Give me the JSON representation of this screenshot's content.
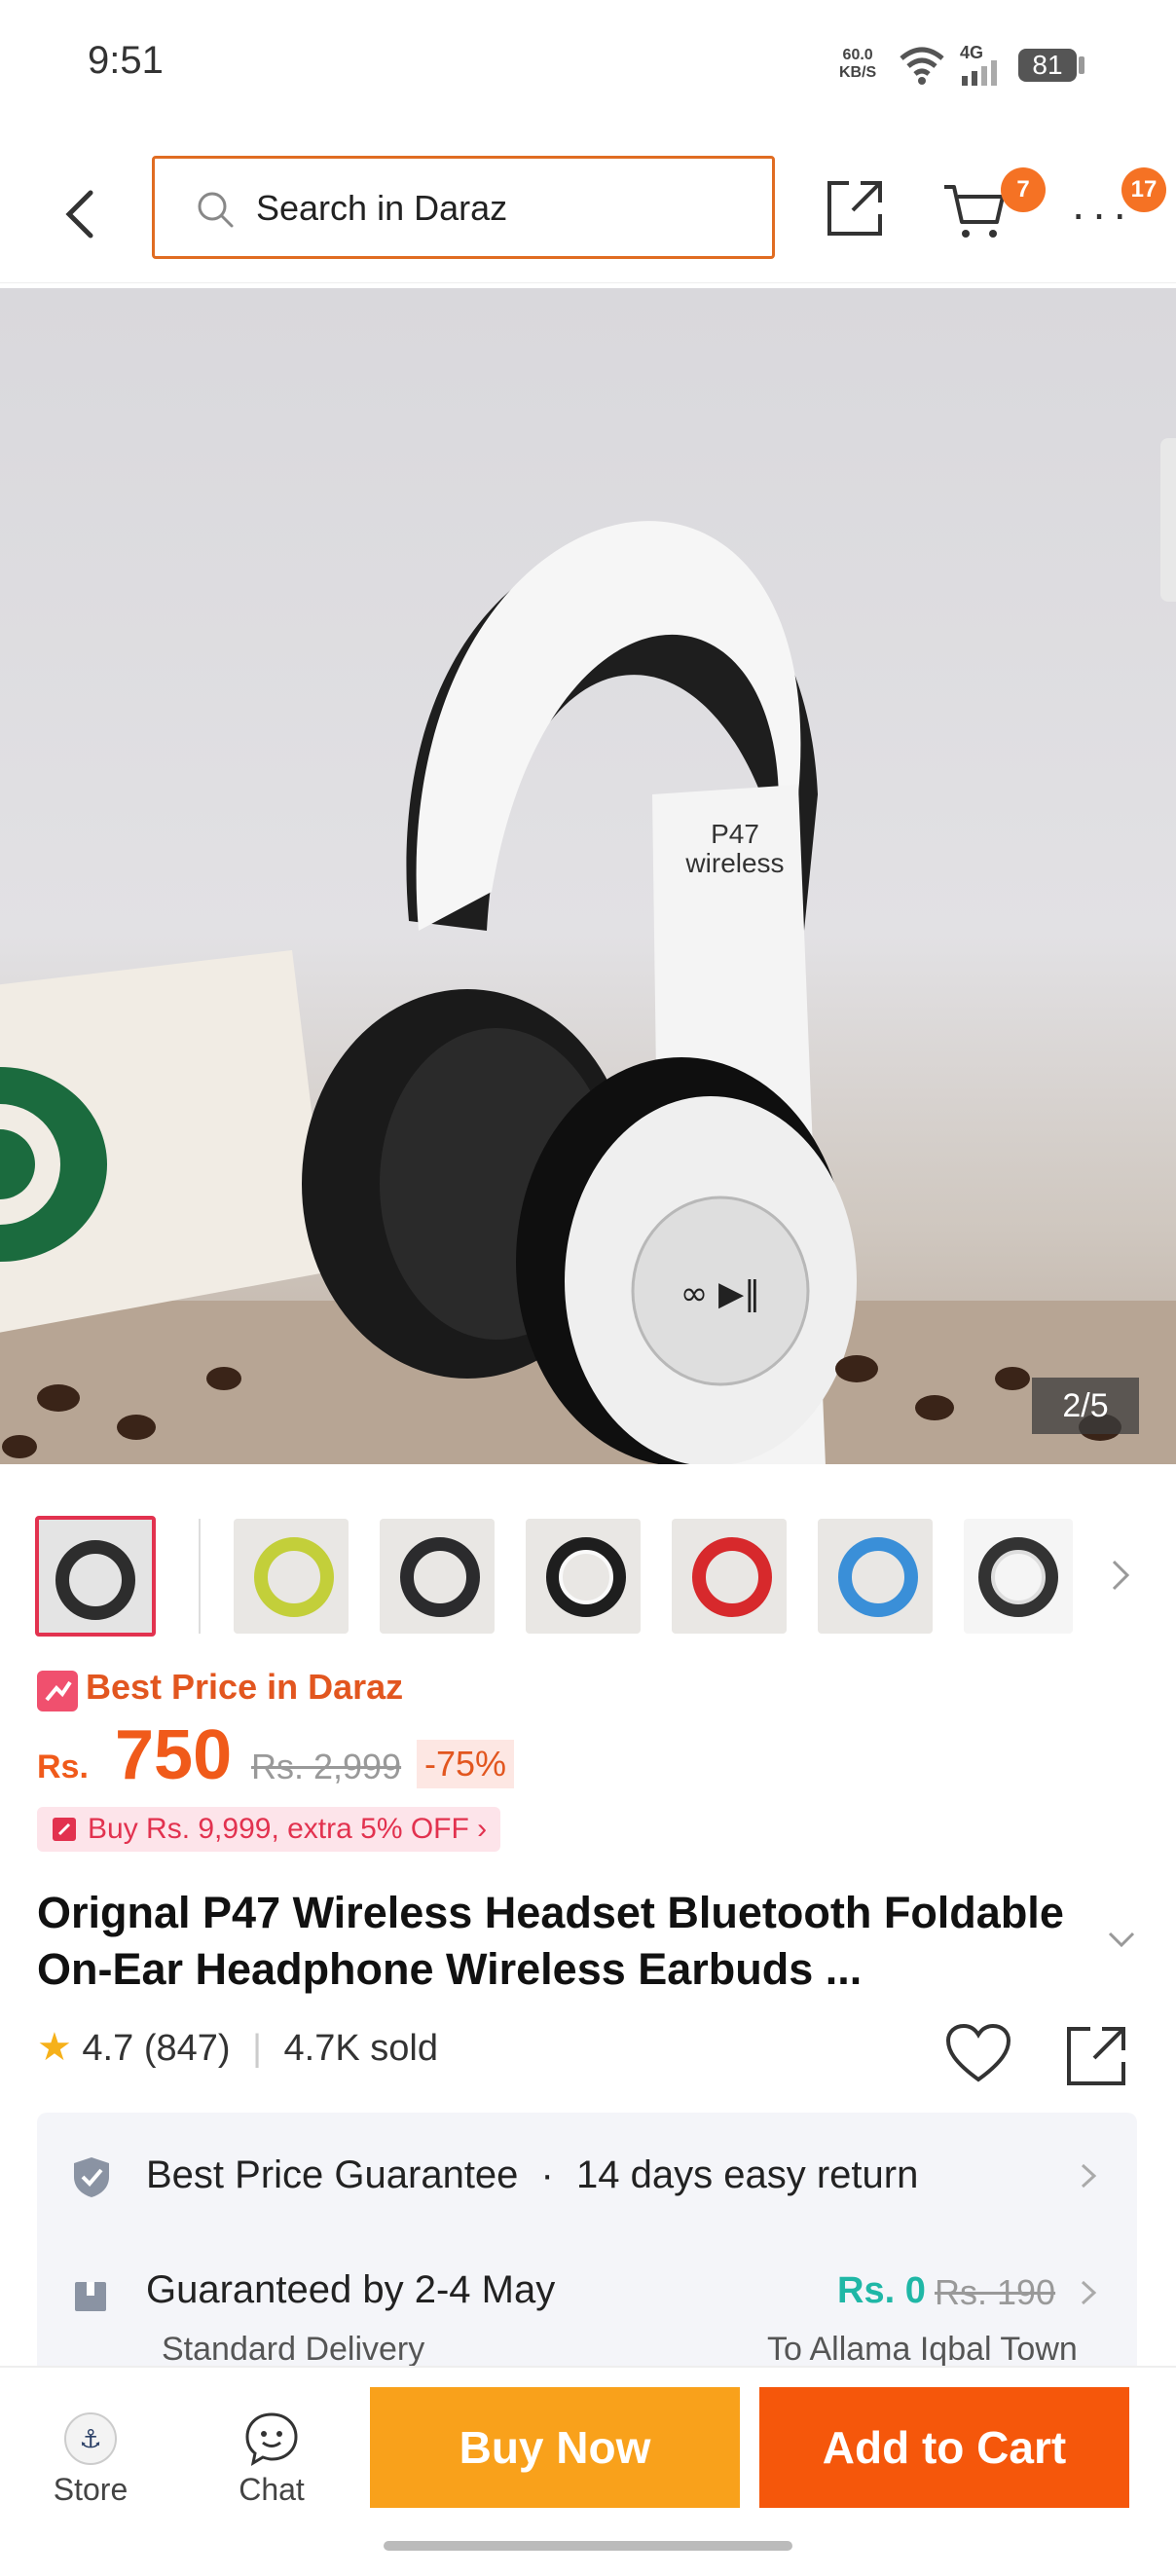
{
  "status_bar": {
    "time": "9:51",
    "speed_top": "60.0",
    "speed_bottom": "KB/S",
    "network": "4G",
    "battery": "81"
  },
  "header": {
    "search_placeholder": "Search in Daraz",
    "cart_count": "7",
    "more_count": "17"
  },
  "hero": {
    "image_counter": "2/5",
    "headphone_print_line1": "P47",
    "headphone_print_line2": "wireless"
  },
  "thumbnails": [
    "black",
    "lime",
    "dark",
    "white-black",
    "red",
    "blue",
    "white"
  ],
  "thumb_colors": [
    "#2d2d2d",
    "#c3cf3a",
    "#2b2b2d",
    "#eeeeee",
    "#d7292c",
    "#3a8fd8",
    "#dddddd"
  ],
  "price": {
    "best_label": "Best Price in Daraz",
    "currency": "Rs.",
    "current": "750",
    "original": "Rs. 2,999",
    "discount": "-75%",
    "promo": "Buy Rs. 9,999, extra 5% OFF"
  },
  "product": {
    "title": "Orignal P47 Wireless Headset Bluetooth Foldable On-Ear Headphone Wireless Earbuds ...",
    "rating": "4.7",
    "reviews": "(847)",
    "sold": "4.7K sold"
  },
  "services": {
    "guarantee": "Best Price Guarantee",
    "returns": "14 days easy return",
    "delivery_title": "Guaranteed by 2-4 May",
    "delivery_type": "Standard Delivery",
    "delivery_fee": "Rs. 0",
    "delivery_old_fee": "Rs. 190",
    "delivery_to": "To Allama Iqbal Town"
  },
  "bottom_bar": {
    "store": "Store",
    "chat": "Chat",
    "buy_now": "Buy Now",
    "add_to_cart": "Add to Cart"
  },
  "colors": {
    "accent": "#f57224",
    "buy_now": "#f9a11b",
    "add_to_cart": "#f5570b",
    "price": "#f05a1a",
    "promo": "#e2324f",
    "free_shipping": "#1fb7a6"
  }
}
